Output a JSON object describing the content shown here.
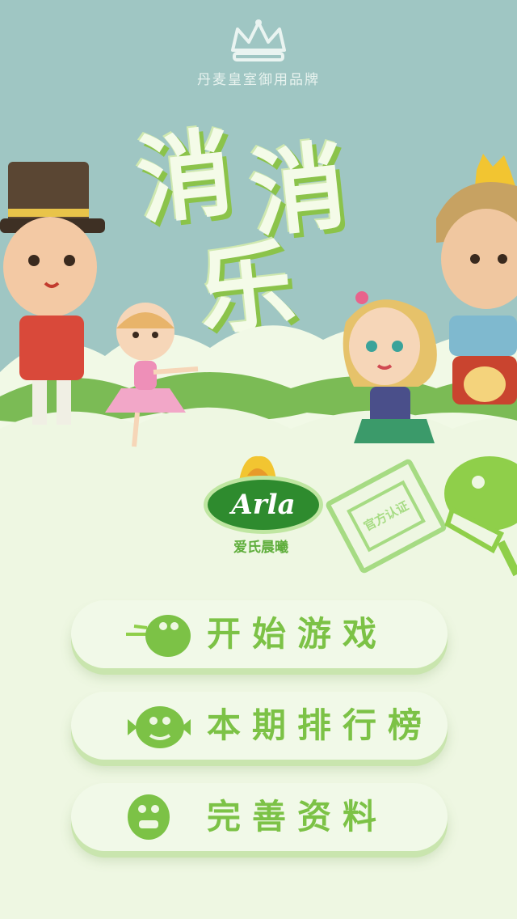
{
  "header": {
    "crown_icon": "crown-icon",
    "brand_subtitle": "丹麦皇室御用品牌"
  },
  "title": {
    "chars": [
      "消",
      "消",
      "乐"
    ]
  },
  "logo": {
    "name": "Arla",
    "subtitle": "爱氏晨曦"
  },
  "stamp": {
    "text": "官方认证"
  },
  "menu": {
    "items": [
      {
        "label": "开始游戏",
        "icon": "monster-icon"
      },
      {
        "label": "本期排行榜",
        "icon": "monster-icon"
      },
      {
        "label": "完善资料",
        "icon": "monster-icon"
      }
    ]
  },
  "colors": {
    "sky": "#9fc6c3",
    "background": "#eef7e2",
    "accent": "#7cc246",
    "arla_green": "#2e8b2e"
  }
}
